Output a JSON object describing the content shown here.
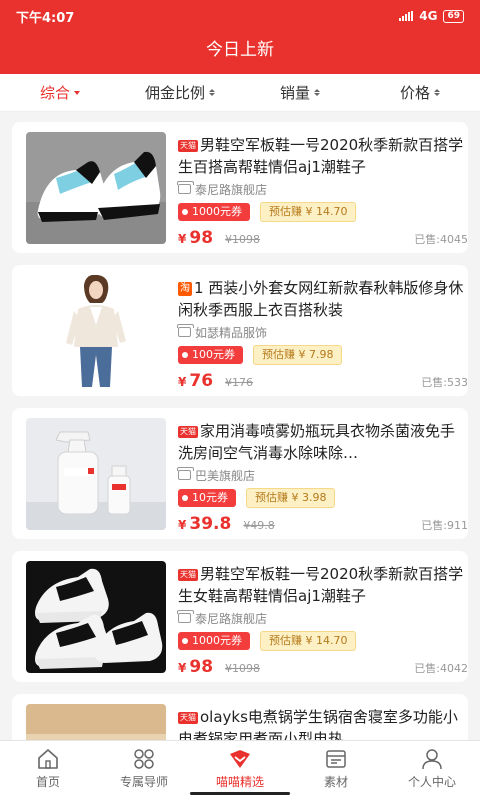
{
  "status": {
    "time": "下午4:07",
    "network": "4G",
    "battery": "69"
  },
  "header": {
    "title": "今日上新"
  },
  "filters": [
    {
      "label": "综合"
    },
    {
      "label": "佣金比例"
    },
    {
      "label": "销量"
    },
    {
      "label": "价格"
    }
  ],
  "products": [
    {
      "platform": "天猫",
      "title": "男鞋空军板鞋一号2020秋季新款百搭学生百搭高帮鞋情侣aj1潮鞋子",
      "shop": "泰尼路旗舰店",
      "coupon": "1000元券",
      "earn": "预估赚 ¥ 14.70",
      "yen": "¥",
      "price": "98",
      "original": "¥1098",
      "sold": "已售:4045"
    },
    {
      "platform": "淘",
      "title": "1 西装小外套女网红新款春秋韩版修身休闲秋季西服上衣百搭秋装",
      "shop": "如瑟精品服饰",
      "coupon": "100元券",
      "earn": "预估赚 ¥ 7.98",
      "yen": "¥",
      "price": "76",
      "original": "¥176",
      "sold": "已售:533"
    },
    {
      "platform": "天猫",
      "title": "家用消毒喷雾奶瓶玩具衣物杀菌液免手洗房间空气消毒水除味除…",
      "shop": "巴美旗舰店",
      "coupon": "10元券",
      "earn": "预估赚 ¥ 3.98",
      "yen": "¥",
      "price": "39.8",
      "original": "¥49.8",
      "sold": "已售:911"
    },
    {
      "platform": "天猫",
      "title": "男鞋空军板鞋一号2020秋季新款百搭学生女鞋高帮鞋情侣aj1潮鞋子",
      "shop": "泰尼路旗舰店",
      "coupon": "1000元券",
      "earn": "预估赚 ¥ 14.70",
      "yen": "¥",
      "price": "98",
      "original": "¥1098",
      "sold": "已售:4042"
    },
    {
      "platform": "天猫",
      "title": "olayks电煮锅学生锅宿舍寝室多功能小电煮锅家用煮面小型电热",
      "shop": "",
      "coupon": "",
      "earn": "",
      "yen": "",
      "price": "",
      "original": "",
      "sold": ""
    }
  ],
  "tabs": [
    {
      "label": "首页",
      "icon": "home-icon"
    },
    {
      "label": "专属导师",
      "icon": "mentor-icon"
    },
    {
      "label": "喵喵精选",
      "icon": "selection-icon"
    },
    {
      "label": "素材",
      "icon": "material-icon"
    },
    {
      "label": "个人中心",
      "icon": "profile-icon"
    }
  ],
  "colors": {
    "brand": "#e9322d",
    "earn_bg": "#fdf0c4"
  }
}
